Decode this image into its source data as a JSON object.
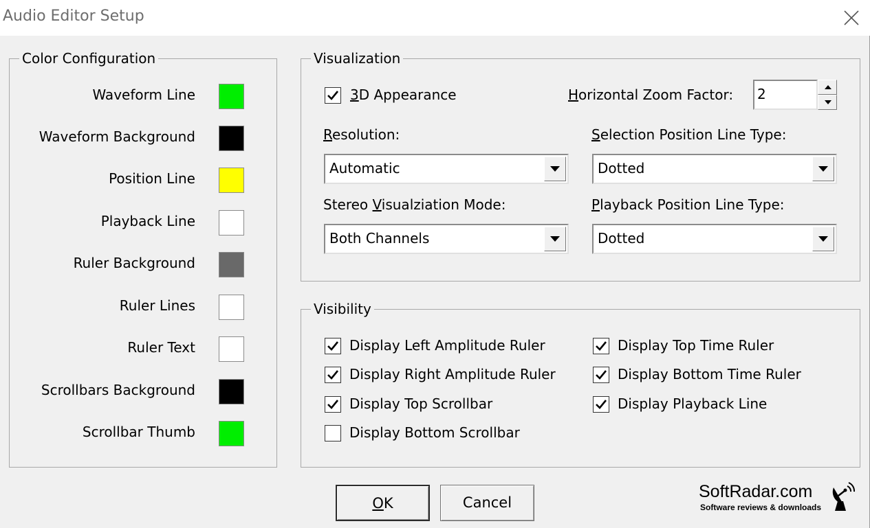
{
  "window": {
    "title": "Audio Editor Setup"
  },
  "color_config": {
    "title": "Color Configuration",
    "items": [
      {
        "label": "Waveform Line",
        "color": "#00ee00"
      },
      {
        "label": "Waveform Background",
        "color": "#000000"
      },
      {
        "label": "Position Line",
        "color": "#ffff00"
      },
      {
        "label": "Playback Line",
        "color": "#ffffff"
      },
      {
        "label": "Ruler Background",
        "color": "#696969"
      },
      {
        "label": "Ruler Lines",
        "color": "#ffffff"
      },
      {
        "label": "Ruler Text",
        "color": "#ffffff"
      },
      {
        "label": "Scrollbars Background",
        "color": "#000000"
      },
      {
        "label": "Scrollbar Thumb",
        "color": "#00ee00"
      }
    ]
  },
  "visualization": {
    "title": "Visualization",
    "appearance_3d": {
      "label_accel": "3",
      "label_rest": "D Appearance",
      "checked": true
    },
    "zoom": {
      "label_accel": "H",
      "label_rest": "orizontal Zoom Factor:",
      "value": "2"
    },
    "resolution": {
      "label_accel": "R",
      "label_rest": "esolution:",
      "value": "Automatic"
    },
    "selection_line": {
      "label_accel": "S",
      "label_rest": "election Position Line Type:",
      "value": "Dotted"
    },
    "stereo_mode": {
      "label_pre": "Stereo ",
      "label_accel": "V",
      "label_rest": "isualziation Mode:",
      "value": "Both Channels"
    },
    "playback_line": {
      "label_accel": "P",
      "label_rest": "layback Position Line Type:",
      "value": "Dotted"
    }
  },
  "visibility": {
    "title": "Visibility",
    "left_items": [
      {
        "label": "Display Left Amplitude Ruler",
        "checked": true
      },
      {
        "label": "Display Right Amplitude Ruler",
        "checked": true
      },
      {
        "label": "Display Top Scrollbar",
        "checked": true
      },
      {
        "label": "Display Bottom Scrollbar",
        "checked": false
      }
    ],
    "right_items": [
      {
        "label": "Display Top Time Ruler",
        "checked": true
      },
      {
        "label": "Display Bottom Time Ruler",
        "checked": true
      },
      {
        "label": "Display Playback Line",
        "checked": true
      }
    ]
  },
  "buttons": {
    "ok_accel": "O",
    "ok_rest": "K",
    "cancel": "Cancel"
  },
  "watermark": {
    "title": "SoftRadar.com",
    "subtitle": "Software reviews & downloads",
    "logo_icon": "satellite-dish-icon"
  }
}
